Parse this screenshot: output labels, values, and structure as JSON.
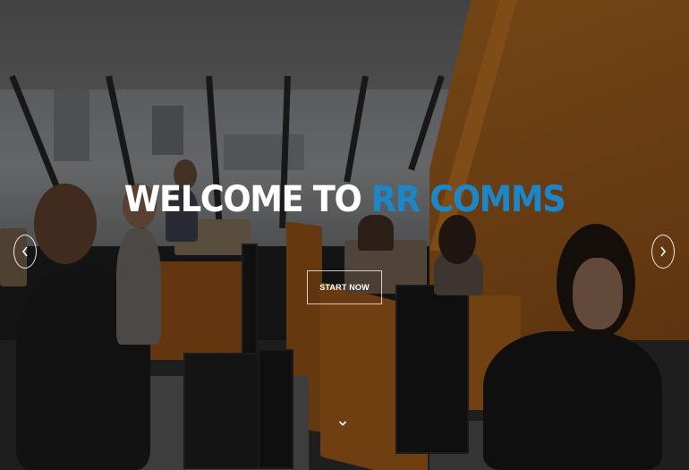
{
  "hero": {
    "title_prefix": "WELCOME TO ",
    "title_accent": "RR COMMS",
    "cta_label": "START NOW"
  },
  "carousel": {
    "prev_icon": "chevron-left-icon",
    "next_icon": "chevron-right-icon"
  },
  "scroll_indicator": {
    "icon": "chevron-down-icon"
  },
  "colors": {
    "accent": "#1b87c9",
    "title_text": "#ffffff",
    "orange_wall": "#a0601e"
  }
}
